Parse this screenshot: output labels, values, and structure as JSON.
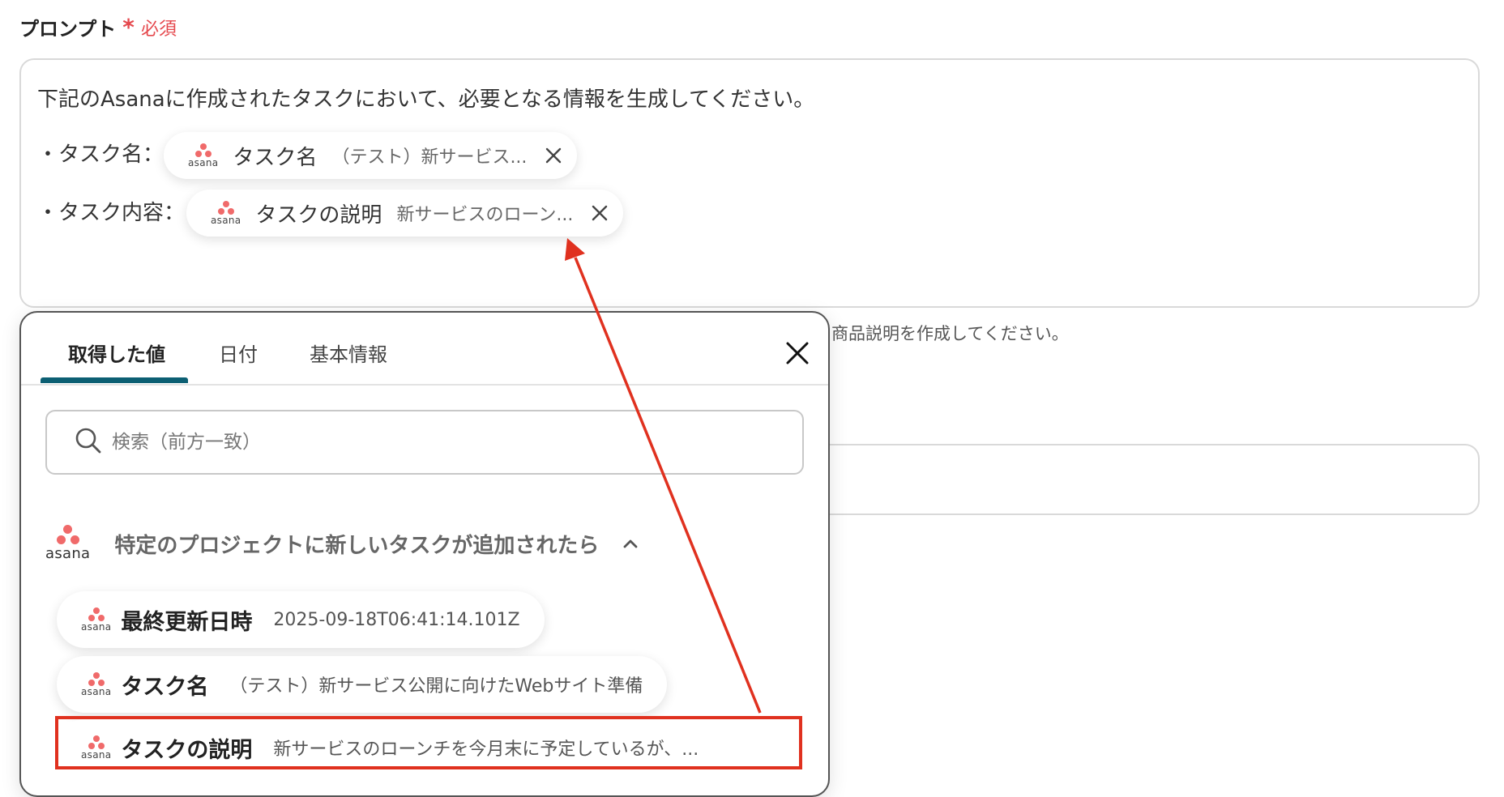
{
  "field": {
    "label": "プロンプト",
    "required_star": "*",
    "required_text": "必須"
  },
  "prompt": {
    "line1": "下記のAsanaに作成されたタスクにおいて、必要となる情報を生成してください。",
    "line2_label": "・タスク名：",
    "line3_label": "・タスク内容：",
    "chips": [
      {
        "name": "タスク名",
        "value": "（テスト）新サービス..."
      },
      {
        "name": "タスクの説明",
        "value": "新サービスのローン..."
      }
    ]
  },
  "helper_text": "商品説明を作成してください。",
  "picker": {
    "tabs": [
      {
        "label": "取得した値",
        "active": true
      },
      {
        "label": "日付",
        "active": false
      },
      {
        "label": "基本情報",
        "active": false
      }
    ],
    "search_placeholder": "検索（前方一致）",
    "group": {
      "logo_word": "asana",
      "title": "特定のプロジェクトに新しいタスクが追加されたら",
      "expanded": true
    },
    "items": [
      {
        "name": "最終更新日時",
        "value": "2025-09-18T06:41:14.101Z"
      },
      {
        "name": "タスク名",
        "value": "（テスト）新サービス公開に向けたWebサイト準備"
      },
      {
        "name": "タスクの説明",
        "value": "新サービスのローンチを今月末に予定しているが、..."
      }
    ]
  },
  "logo_word": "asana",
  "colors": {
    "required": "#e5484d",
    "tab_accent": "#0c5f73",
    "asana_dot": "#f06a6a",
    "annotation": "#e0311f"
  },
  "icons": {
    "search": "search-icon",
    "close": "close-icon",
    "chevron": "chevron-up-icon"
  }
}
